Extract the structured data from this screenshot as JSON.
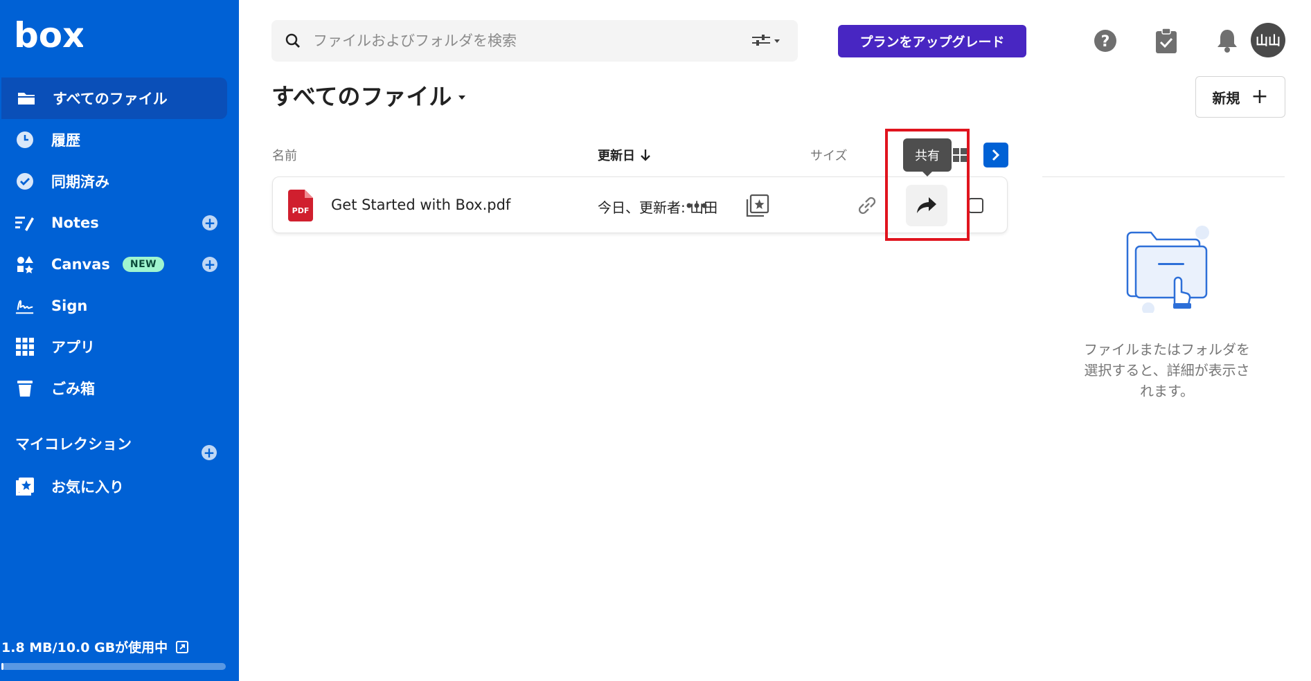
{
  "brand": {
    "logo_text": "box"
  },
  "sidebar": {
    "items": [
      {
        "label": "すべてのファイル",
        "active": true,
        "icon": "folder-icon"
      },
      {
        "label": "履歴",
        "icon": "clock-icon"
      },
      {
        "label": "同期済み",
        "icon": "check-circle-icon"
      },
      {
        "label": "Notes",
        "icon": "notes-icon",
        "has_add": true
      },
      {
        "label": "Canvas",
        "icon": "canvas-icon",
        "badge": "NEW",
        "has_add": true
      },
      {
        "label": "Sign",
        "icon": "sign-icon"
      },
      {
        "label": "アプリ",
        "icon": "apps-grid-icon"
      },
      {
        "label": "ごみ箱",
        "icon": "trash-icon"
      }
    ],
    "collections_title": "マイコレクション",
    "favorites_label": "お気に入り",
    "storage_text": "1.8 MB/10.0 GBが使用中",
    "storage_used_fraction": 0.00018
  },
  "topbar": {
    "search_placeholder": "ファイルおよびフォルダを検索",
    "upgrade_label": "プランをアップグレード",
    "avatar_initials": "山山"
  },
  "header": {
    "title": "すべてのファイル",
    "new_label": "新規"
  },
  "columns": {
    "name": "名前",
    "updated": "更新日",
    "size": "サイズ"
  },
  "files": [
    {
      "name": "Get Started with Box.pdf",
      "updated": "今日、更新者: 山田",
      "type_label": "PDF"
    }
  ],
  "tooltip": {
    "text": "共有"
  },
  "details": {
    "empty_text": "ファイルまたはフォルダを選択すると、詳細が表示されます。"
  },
  "colors": {
    "sidebar_bg": "#0061d5",
    "upgrade_bg": "#4826c2",
    "highlight": "#e0141e",
    "new_badge_bg": "#9ff5cf"
  }
}
